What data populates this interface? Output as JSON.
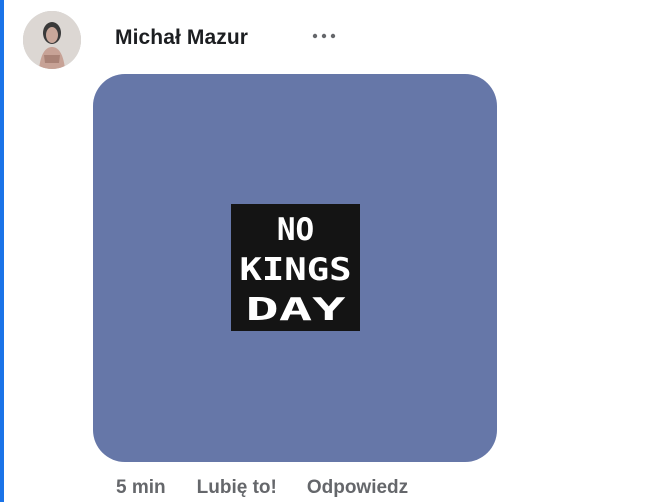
{
  "comment": {
    "author": "Michał Mazur",
    "more_icon": "more-horizontal-icon",
    "sticker": {
      "background": "#6677a8",
      "logo_text": [
        "NO",
        "KINGS",
        "DAY"
      ]
    },
    "timestamp": "5 min",
    "like_label": "Lubię to!",
    "reply_label": "Odpowiedz"
  },
  "colors": {
    "accent_bar": "#1a73e8",
    "meta_text": "#65676b"
  }
}
